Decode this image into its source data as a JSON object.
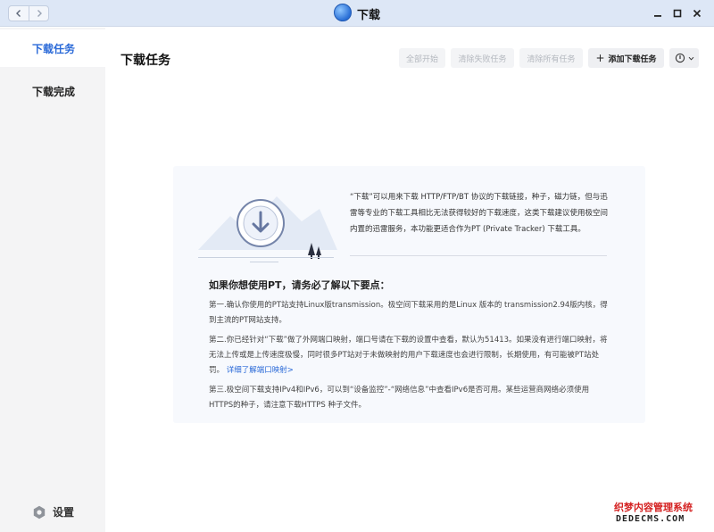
{
  "window": {
    "title": "下载"
  },
  "sidebar": {
    "items": [
      {
        "label": "下载任务",
        "active": true
      },
      {
        "label": "下载完成",
        "active": false
      }
    ],
    "settings_label": "设置"
  },
  "header": {
    "title": "下载任务"
  },
  "toolbar": {
    "start_all": "全部开始",
    "clear_failed": "清除失败任务",
    "clear_all": "清除所有任务",
    "add_task": "添加下载任务"
  },
  "info": {
    "intro": "“下载”可以用来下载 HTTP/FTP/BT 协议的下载链接，种子，磁力链，但与迅雷等专业的下载工具相比无法获得较好的下载速度，这类下载建议使用极空间内置的迅雷服务，本功能更适合作为PT (Private Tracker) 下载工具。",
    "heading": "如果你想使用PT，请务必了解以下要点：",
    "point1": "第一.确认你使用的PT站支持Linux版transmission。极空间下载采用的是Linux 版本的 transmission2.94版内核，得到主流的PT网站支持。",
    "point2": "第二.你已经针对“下载”做了外网端口映射，端口号请在下载的设置中查看，默认为51413。如果没有进行端口映射，将无法上传或是上传速度极慢，同时很多PT站对于未做映射的用户下载速度也会进行限制，长期使用，有可能被PT站处罚。",
    "point2_link": "详细了解端口映射>",
    "point3": "第三.极空间下载支持IPv4和IPv6，可以到“设备监控”-“网络信息”中查看IPv6是否可用。某些运营商网络必须使用HTTPS的种子，请注意下载HTTPS 种子文件。"
  },
  "watermark": {
    "line1": "织梦内容管理系统",
    "line2": "DEDECMS.COM"
  },
  "colors": {
    "accent": "#2b6ad8",
    "titlebar": "#dde7f6",
    "sidebar": "#f4f4f5",
    "card": "#f7f9fd"
  }
}
